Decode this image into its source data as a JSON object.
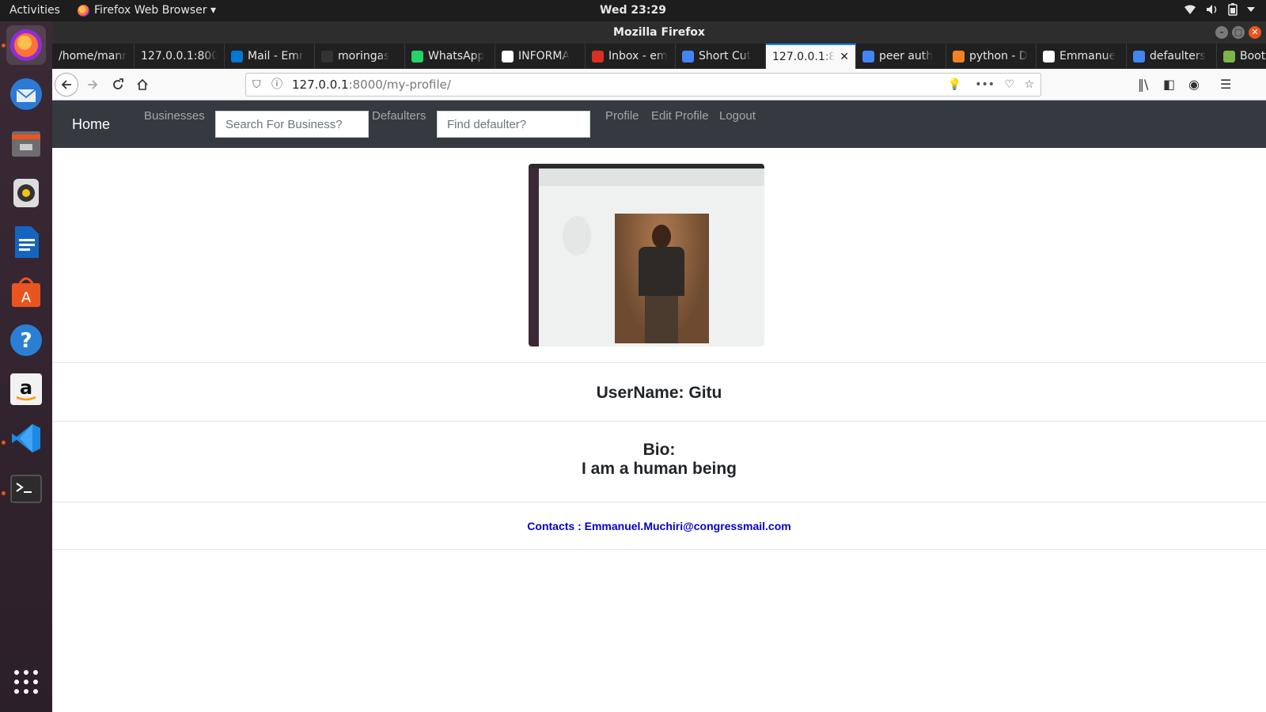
{
  "topbar": {
    "activities": "Activities",
    "app_menu": "Firefox Web Browser ▾",
    "clock": "Wed 23:29"
  },
  "window": {
    "title": "Mozilla Firefox"
  },
  "tabs": [
    {
      "label": "/home/mann",
      "favicon_color": "#202020"
    },
    {
      "label": "127.0.0.1:800",
      "favicon_color": "#202020"
    },
    {
      "label": "Mail - Emr",
      "favicon_color": "#0078d4"
    },
    {
      "label": "moringas",
      "favicon_color": "#333333"
    },
    {
      "label": "WhatsApp",
      "favicon_color": "#25d366"
    },
    {
      "label": "INFORMA",
      "favicon_color": "#ffffff"
    },
    {
      "label": "Inbox - em",
      "favicon_color": "#d93025"
    },
    {
      "label": "Short Cut",
      "favicon_color": "#4285f4"
    },
    {
      "label": "127.0.0.1:8",
      "favicon_color": "#f9f9fa",
      "active": true
    },
    {
      "label": "peer auth",
      "favicon_color": "#4285f4"
    },
    {
      "label": "python - D",
      "favicon_color": "#f48024"
    },
    {
      "label": "Emmanue",
      "favicon_color": "#ffffff"
    },
    {
      "label": "defaulters",
      "favicon_color": "#4285f4"
    },
    {
      "label": "Bootstrap",
      "favicon_color": "#7ab648"
    }
  ],
  "urlbar": {
    "host": "127.0.0.1",
    "path": ":8000/my-profile/"
  },
  "site": {
    "brand": "Home",
    "nav_businesses": "Businesses",
    "search_business_placeholder": "Search For Business?",
    "nav_defaulters": "Defaulters",
    "find_defaulter_placeholder": "Find defaulter?",
    "nav_profile": "Profile",
    "nav_edit_profile": "Edit Profile",
    "nav_logout": "Logout"
  },
  "profile": {
    "username": "UserName: Gitu",
    "bio_label": "Bio:",
    "bio_text": "I am a human being",
    "contacts": "Contacts : Emmanuel.Muchiri@congressmail.com"
  },
  "colors": {
    "navbar_bg": "#343a40",
    "link_blue": "#0000cc",
    "ubuntu_orange": "#e95420"
  }
}
